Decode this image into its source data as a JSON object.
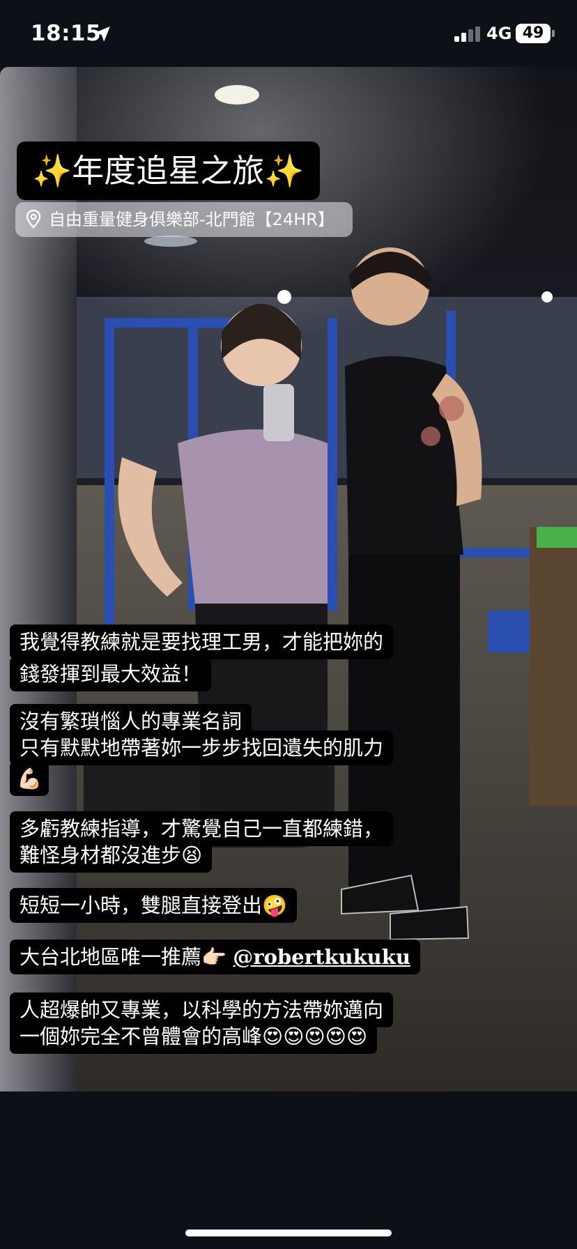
{
  "status_bar": {
    "time": "18:15",
    "network": "4G",
    "battery": "49"
  },
  "story": {
    "title": "✨年度追星之旅✨",
    "location": "自由重量健身俱樂部-北門館【24HR】",
    "captions": {
      "c1_line1": "我覺得教練就是要找理工男，才能把妳的",
      "c1_line2": "錢發揮到最大效益！",
      "c2_line1": "沒有繁瑣惱人的專業名詞",
      "c2_line2": "只有默默地帶著妳一步步找回遺失的肌力",
      "c2_emoji": "💪🏻",
      "c3_line1": "多虧教練指導，才驚覺自己一直都練錯，",
      "c3_line2": "難怪身材都沒進步",
      "c3_emoji": "😫",
      "c4_text": "短短一小時，雙腿直接登出",
      "c4_emoji": "🤪",
      "c5_text": "大台北地區唯一推薦",
      "c5_emoji": "👉🏻",
      "c5_mention": "@robertkukuku",
      "c6_line1": "人超爆帥又專業，以科學的方法帶妳邁向",
      "c6_line2": "一個妳完全不曾體會的高峰",
      "c6_emoji": "😍😍😍😍😍"
    }
  },
  "colors": {
    "background": "#0e1018",
    "caption_bg": "#000000",
    "location_bg": "rgba(235,235,240,0.55)"
  }
}
